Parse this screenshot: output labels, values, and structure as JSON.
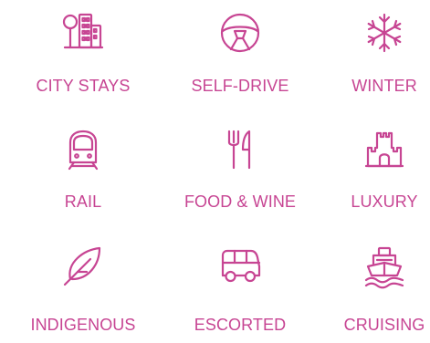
{
  "accent_color": "#c74593",
  "categories": [
    {
      "label": "CITY STAYS",
      "icon": "city-buildings-tree-icon"
    },
    {
      "label": "SELF-DRIVE",
      "icon": "steering-wheel-icon"
    },
    {
      "label": "WINTER",
      "icon": "snowflake-icon"
    },
    {
      "label": "RAIL",
      "icon": "train-icon"
    },
    {
      "label": "FOOD & WINE",
      "icon": "fork-knife-icon"
    },
    {
      "label": "LUXURY",
      "icon": "castle-icon"
    },
    {
      "label": "INDIGENOUS",
      "icon": "feather-icon"
    },
    {
      "label": "ESCORTED",
      "icon": "van-icon"
    },
    {
      "label": "CRUISING",
      "icon": "cruise-ship-icon"
    }
  ]
}
